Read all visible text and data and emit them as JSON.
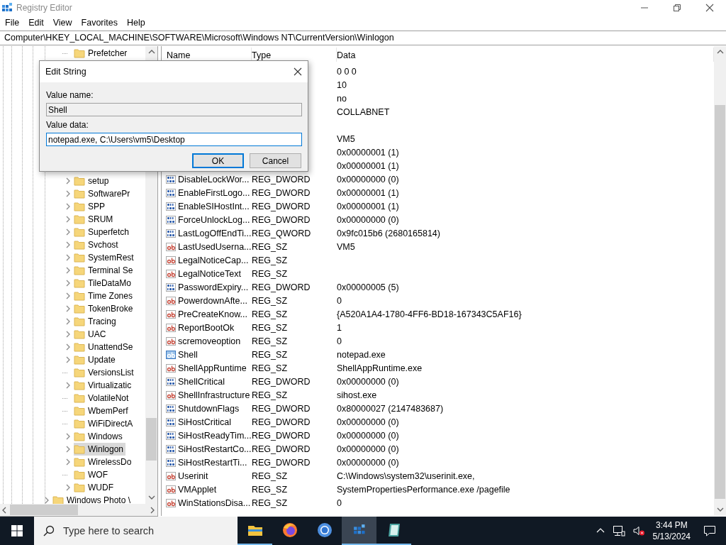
{
  "window": {
    "title": "Registry Editor"
  },
  "menu": [
    "File",
    "Edit",
    "View",
    "Favorites",
    "Help"
  ],
  "address_bar": {
    "path": "Computer\\HKEY_LOCAL_MACHINE\\SOFTWARE\\Microsoft\\Windows NT\\CurrentVersion\\Winlogon"
  },
  "tree": {
    "children": [
      {
        "children": [
          {
            "children": [
              {
                "label": "Prefetcher",
                "expandable": false,
                "selected": false
              },
              {
                "label": "setup",
                "expandable": true,
                "selected": false
              },
              {
                "label": "SoftwarePr",
                "expandable": true,
                "selected": false
              },
              {
                "label": "SPP",
                "expandable": true,
                "selected": false
              },
              {
                "label": "SRUM",
                "expandable": true,
                "selected": false
              },
              {
                "label": "Superfetch",
                "expandable": true,
                "selected": false
              },
              {
                "label": "Svchost",
                "expandable": true,
                "selected": false
              },
              {
                "label": "SystemRest",
                "expandable": true,
                "selected": false
              },
              {
                "label": "Terminal Se",
                "expandable": true,
                "selected": false
              },
              {
                "label": "TileDataMo",
                "expandable": true,
                "selected": false
              },
              {
                "label": "Time Zones",
                "expandable": true,
                "selected": false
              },
              {
                "label": "TokenBroke",
                "expandable": true,
                "selected": false
              },
              {
                "label": "Tracing",
                "expandable": true,
                "selected": false
              },
              {
                "label": "UAC",
                "expandable": true,
                "selected": false
              },
              {
                "label": "UnattendSe",
                "expandable": true,
                "selected": false
              },
              {
                "label": "Update",
                "expandable": true,
                "selected": false
              },
              {
                "label": "VersionsList",
                "expandable": false,
                "selected": false
              },
              {
                "label": "Virtualizatic",
                "expandable": true,
                "selected": false
              },
              {
                "label": "VolatileNot",
                "expandable": false,
                "selected": false
              },
              {
                "label": "WbemPerf",
                "expandable": false,
                "selected": false
              },
              {
                "label": "WiFiDirectA",
                "expandable": false,
                "selected": false
              },
              {
                "label": "Windows",
                "expandable": true,
                "selected": false
              },
              {
                "label": "Winlogon",
                "expandable": true,
                "selected": true
              },
              {
                "label": "WirelessDo",
                "expandable": true,
                "selected": false
              },
              {
                "label": "WOF",
                "expandable": false,
                "selected": false
              },
              {
                "label": "WUDF",
                "expandable": true,
                "selected": false
              }
            ]
          }
        ]
      },
      {
        "label": "Windows Photo \\",
        "expandable": true,
        "selected": false
      }
    ]
  },
  "list": {
    "columns": [
      "Name",
      "Type",
      "Data"
    ],
    "rows": [
      {
        "data": "0 0 0"
      },
      {
        "data": "10"
      },
      {
        "data": "no"
      },
      {
        "data": "COLLABNET"
      },
      {},
      {
        "data": "VM5"
      },
      {
        "data": "0x00000001 (1)"
      },
      {
        "data": "0x00000001 (1)"
      },
      {
        "name": "DisableLockWor...",
        "type": "REG_DWORD",
        "data": "0x00000000 (0)",
        "kind": "binary",
        "selected": false
      },
      {
        "name": "EnableFirstLogo...",
        "type": "REG_DWORD",
        "data": "0x00000001 (1)",
        "kind": "binary",
        "selected": false
      },
      {
        "name": "EnableSIHostInt...",
        "type": "REG_DWORD",
        "data": "0x00000001 (1)",
        "kind": "binary",
        "selected": false
      },
      {
        "name": "ForceUnlockLog...",
        "type": "REG_DWORD",
        "data": "0x00000000 (0)",
        "kind": "binary",
        "selected": false
      },
      {
        "name": "LastLogOffEndTi...",
        "type": "REG_QWORD",
        "data": "0x9fc015b6 (2680165814)",
        "kind": "binary",
        "selected": false
      },
      {
        "name": "LastUsedUserna...",
        "type": "REG_SZ",
        "data": "VM5",
        "kind": "string",
        "selected": false
      },
      {
        "name": "LegalNoticeCap...",
        "type": "REG_SZ",
        "kind": "string",
        "selected": false
      },
      {
        "name": "LegalNoticeText",
        "type": "REG_SZ",
        "kind": "string",
        "selected": false
      },
      {
        "name": "PasswordExpiry...",
        "type": "REG_DWORD",
        "data": "0x00000005 (5)",
        "kind": "binary",
        "selected": false
      },
      {
        "name": "PowerdownAfte...",
        "type": "REG_SZ",
        "data": "0",
        "kind": "string",
        "selected": false
      },
      {
        "name": "PreCreateKnow...",
        "type": "REG_SZ",
        "data": "{A520A1A4-1780-4FF6-BD18-167343C5AF16}",
        "kind": "string",
        "selected": false
      },
      {
        "name": "ReportBootOk",
        "type": "REG_SZ",
        "data": "1",
        "kind": "string",
        "selected": false
      },
      {
        "name": "scremoveoption",
        "type": "REG_SZ",
        "data": "0",
        "kind": "string",
        "selected": false
      },
      {
        "name": "Shell",
        "type": "REG_SZ",
        "data": "notepad.exe",
        "kind": "string",
        "selected": true
      },
      {
        "name": "ShellAppRuntime",
        "type": "REG_SZ",
        "data": "ShellAppRuntime.exe",
        "kind": "string",
        "selected": false
      },
      {
        "name": "ShellCritical",
        "type": "REG_DWORD",
        "data": "0x00000000 (0)",
        "kind": "binary",
        "selected": false
      },
      {
        "name": "ShellInfrastructure",
        "type": "REG_SZ",
        "data": "sihost.exe",
        "kind": "string",
        "selected": false
      },
      {
        "name": "ShutdownFlags",
        "type": "REG_DWORD",
        "data": "0x80000027 (2147483687)",
        "kind": "binary",
        "selected": false
      },
      {
        "name": "SiHostCritical",
        "type": "REG_DWORD",
        "data": "0x00000000 (0)",
        "kind": "binary",
        "selected": false
      },
      {
        "name": "SiHostReadyTim...",
        "type": "REG_DWORD",
        "data": "0x00000000 (0)",
        "kind": "binary",
        "selected": false
      },
      {
        "name": "SiHostRestartCo...",
        "type": "REG_DWORD",
        "data": "0x00000000 (0)",
        "kind": "binary",
        "selected": false
      },
      {
        "name": "SiHostRestartTi...",
        "type": "REG_DWORD",
        "data": "0x00000000 (0)",
        "kind": "binary",
        "selected": false
      },
      {
        "name": "Userinit",
        "type": "REG_SZ",
        "data": "C:\\Windows\\system32\\userinit.exe,",
        "kind": "string",
        "selected": false
      },
      {
        "name": "VMApplet",
        "type": "REG_SZ",
        "data": "SystemPropertiesPerformance.exe /pagefile",
        "kind": "string",
        "selected": false
      },
      {
        "name": "WinStationsDisa...",
        "type": "REG_SZ",
        "data": "0",
        "kind": "string",
        "selected": false
      }
    ]
  },
  "dialog": {
    "title": "Edit String",
    "fields": [
      {
        "label": "Value name:",
        "value": "Shell",
        "disabled": true,
        "focused": false
      },
      {
        "label": "Value data:",
        "value": "notepad.exe, C:\\Users\\vm5\\Desktop",
        "disabled": false,
        "focused": true
      }
    ],
    "buttons": [
      {
        "label": "OK",
        "default": true
      },
      {
        "label": "Cancel",
        "default": false
      }
    ]
  },
  "taskbar": {
    "search": {
      "placeholder": "Type here to search"
    },
    "apps": [
      {
        "kind": "explorer",
        "running": true,
        "active": false
      },
      {
        "kind": "firefox",
        "running": false,
        "active": false
      },
      {
        "kind": "chrome",
        "running": false,
        "active": false
      },
      {
        "kind": "regedit",
        "running": true,
        "active": true
      },
      {
        "kind": "notebook",
        "running": true,
        "active": false
      }
    ],
    "volume_muted": true,
    "clock": {
      "time": "3:44 PM",
      "date": "5/13/2024"
    }
  }
}
